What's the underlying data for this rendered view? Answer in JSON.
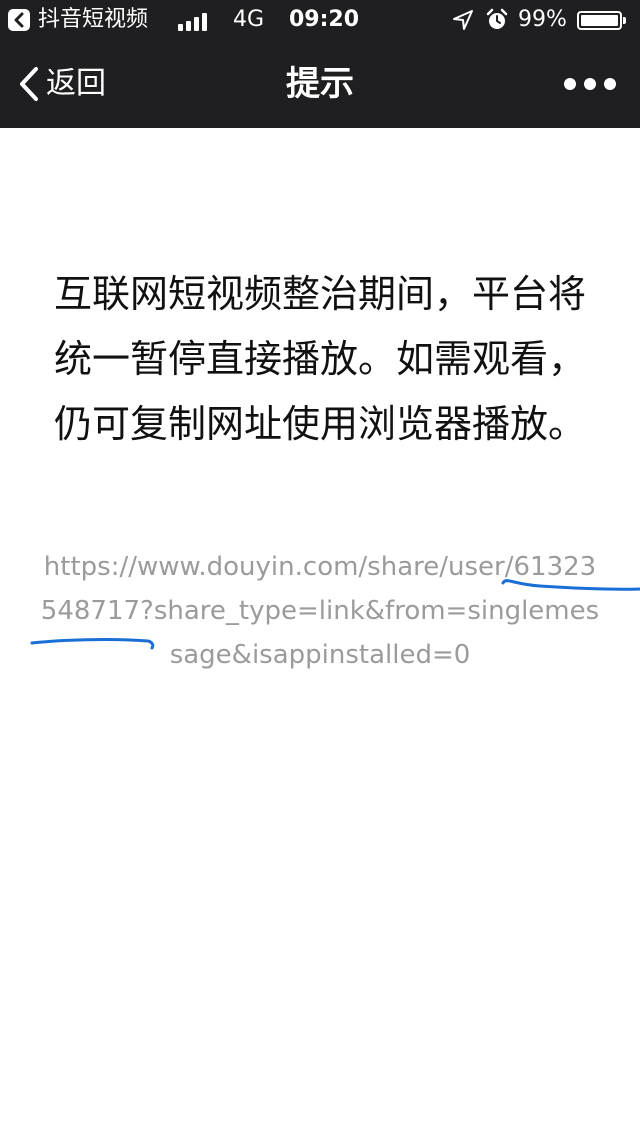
{
  "status_bar": {
    "back_app_name": "抖音短视频",
    "network": "4G",
    "time": "09:20",
    "battery_percent": "99%",
    "icons": [
      "back-app-icon",
      "signal-icon",
      "location-arrow-icon",
      "alarm-clock-icon",
      "battery-icon"
    ]
  },
  "nav": {
    "back_label": "返回",
    "title": "提示",
    "more_icon": "more-dots-icon"
  },
  "content": {
    "notice": "互联网短视频整治期间，平台将统一暂停直接播放。如需观看，仍可复制网址使用浏览器播放。",
    "url": "https://www.douyin.com/share/user/61323548717?share_type=link&from=singlemessage&isappinstalled=0"
  },
  "colors": {
    "bar_background": "#1f1f21",
    "url_text": "#9b9b9b",
    "annotation_stroke": "#1a6fd6"
  }
}
